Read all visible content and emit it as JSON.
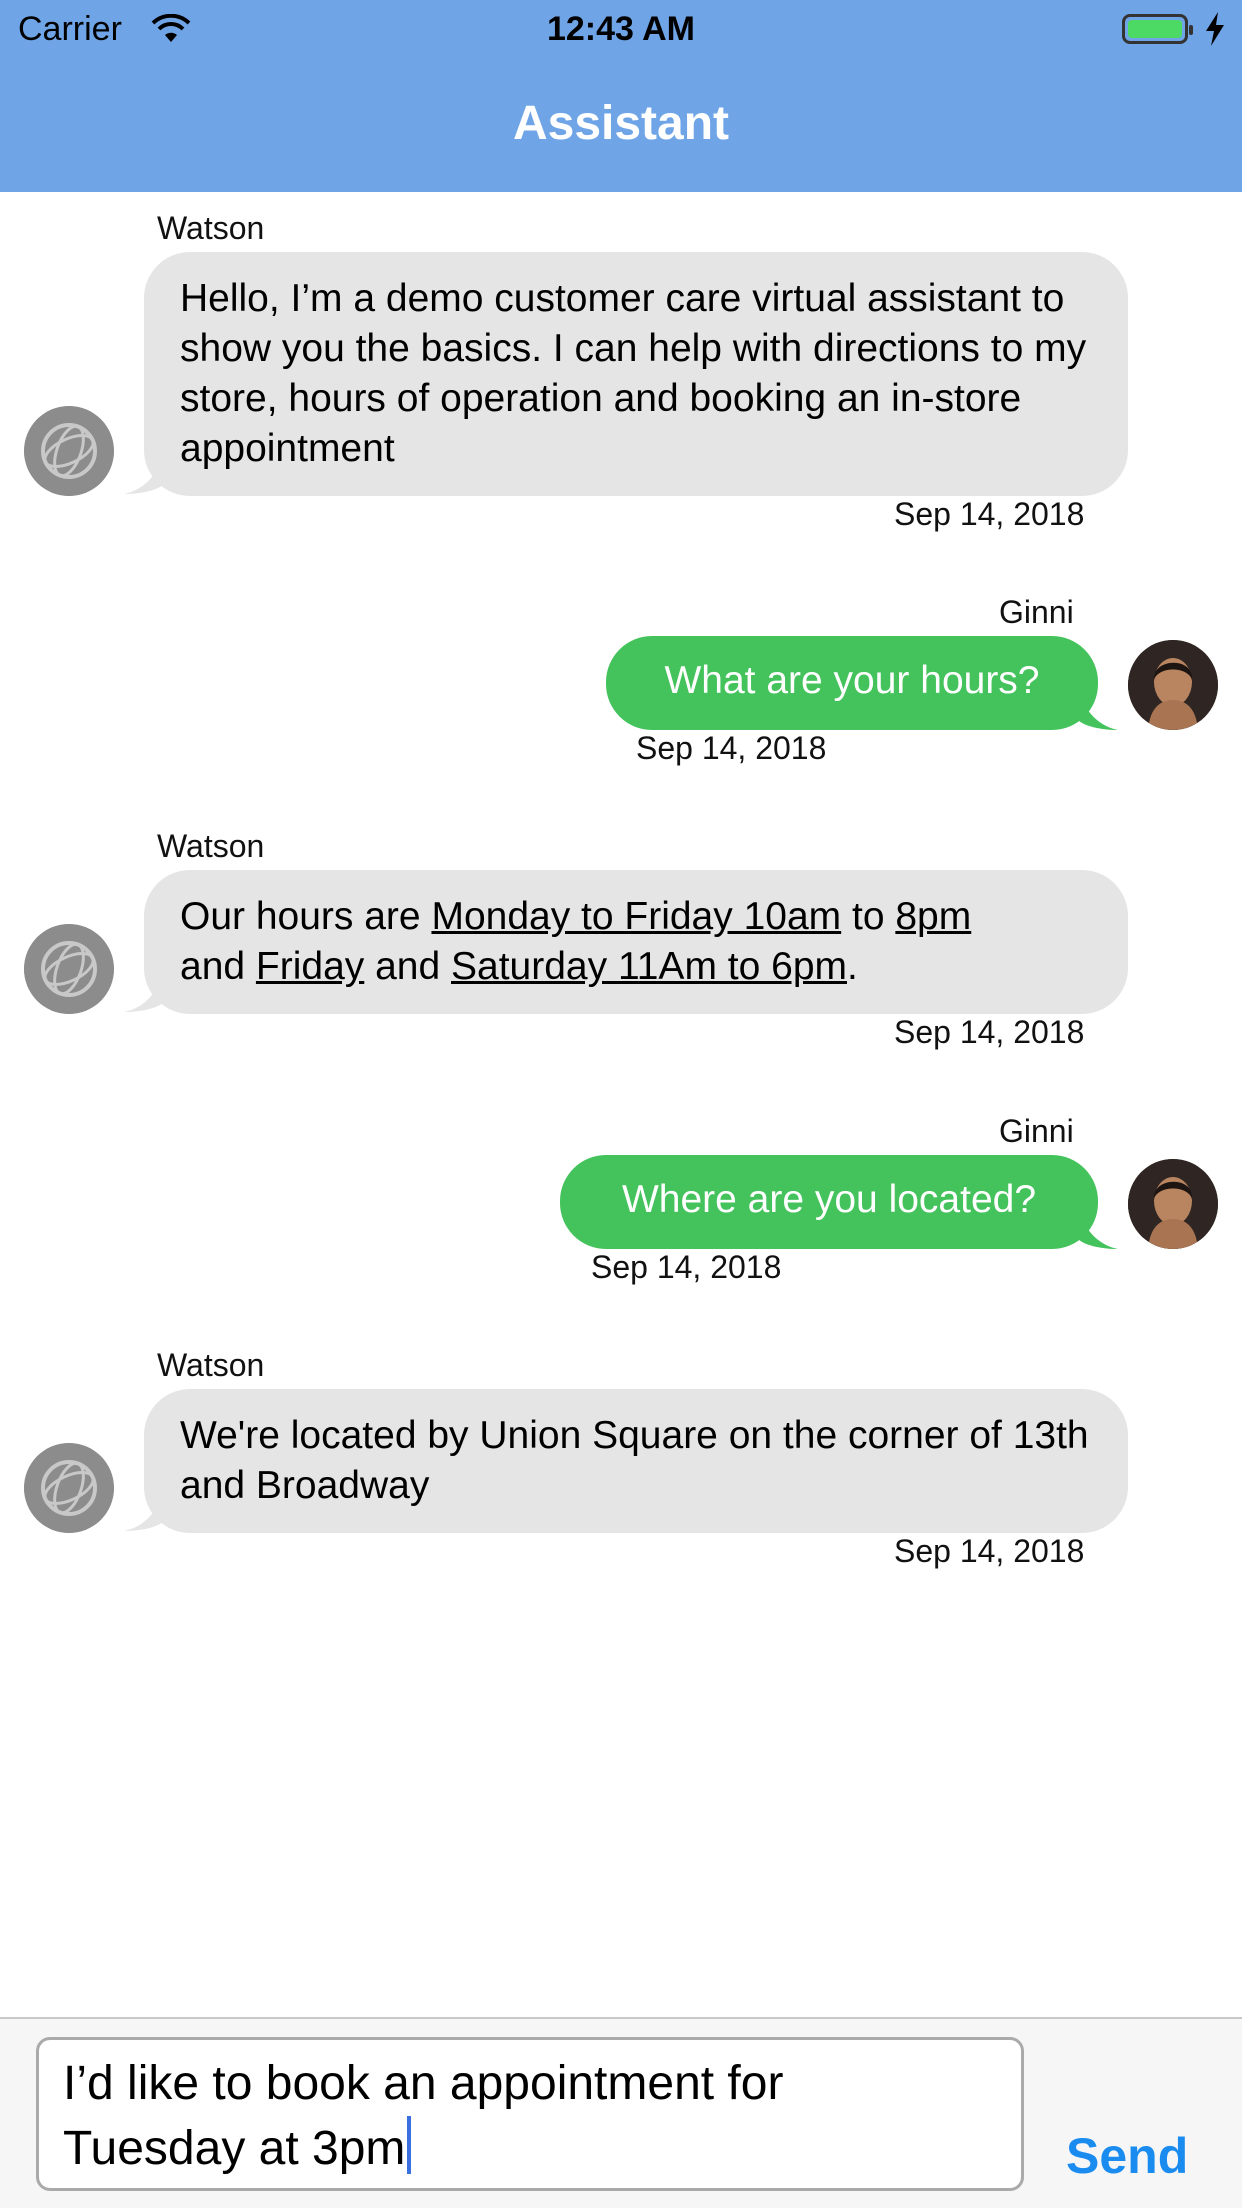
{
  "status_bar": {
    "carrier": "Carrier",
    "time": "12:43 AM"
  },
  "nav": {
    "title": "Assistant"
  },
  "colors": {
    "nav_bg": "#6fa5e7",
    "incoming_bubble": "#e5e5e5",
    "outgoing_bubble": "#44c35c",
    "send_text": "#1a8cf0"
  },
  "messages": [
    {
      "sender": "Watson",
      "direction": "incoming",
      "text": "Hello, I’m a demo customer care virtual assistant to show you the basics.  I can help with directions to my store, hours of operation and booking an in-store appointment",
      "date": "Sep 14, 2018"
    },
    {
      "sender": "Ginni",
      "direction": "outgoing",
      "text": "What are your hours?",
      "date": "Sep 14, 2018"
    },
    {
      "sender": "Watson",
      "direction": "incoming",
      "parts": [
        "Our hours are ",
        "Monday to Friday 10am",
        " to ",
        "8pm",
        "and ",
        "Friday",
        " and ",
        "Saturday 11Am to 6pm",
        "."
      ],
      "date": "Sep 14, 2018"
    },
    {
      "sender": "Ginni",
      "direction": "outgoing",
      "text": "Where are you located?",
      "date": "Sep 14, 2018"
    },
    {
      "sender": "Watson",
      "direction": "incoming",
      "text": "We're located by Union Square on the corner of 13th and Broadway",
      "date": "Sep 14, 2018"
    }
  ],
  "composer": {
    "line1": "I’d like to book an appointment for",
    "line2": "Tuesday at 3pm",
    "send_label": "Send"
  },
  "icons": [
    "wifi-icon",
    "battery-icon",
    "charging-bolt-icon",
    "watson-avatar",
    "user-avatar"
  ]
}
